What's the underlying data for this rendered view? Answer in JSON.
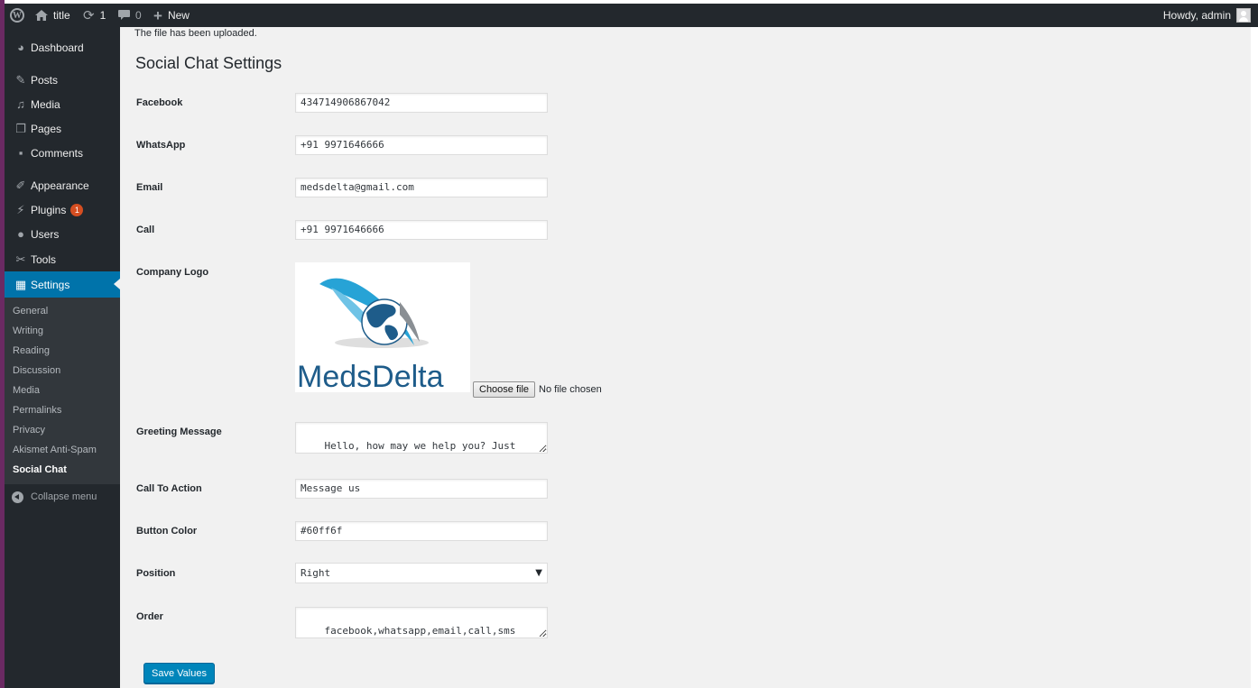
{
  "adminbar": {
    "site_title": "title",
    "updates_count": "1",
    "comments_count": "0",
    "new_label": "New",
    "howdy": "Howdy, admin"
  },
  "sidebar": {
    "items": [
      {
        "label": "Dashboard",
        "icon": "dashboard-icon"
      },
      {
        "label": "Posts",
        "icon": "pin-icon"
      },
      {
        "label": "Media",
        "icon": "media-icon"
      },
      {
        "label": "Pages",
        "icon": "pages-icon"
      },
      {
        "label": "Comments",
        "icon": "comments-icon"
      },
      {
        "label": "Appearance",
        "icon": "brush-icon"
      },
      {
        "label": "Plugins",
        "icon": "plug-icon",
        "badge": "1"
      },
      {
        "label": "Users",
        "icon": "user-icon"
      },
      {
        "label": "Tools",
        "icon": "wrench-icon"
      },
      {
        "label": "Settings",
        "icon": "settings-icon"
      }
    ],
    "submenu": [
      "General",
      "Writing",
      "Reading",
      "Discussion",
      "Media",
      "Permalinks",
      "Privacy",
      "Akismet Anti-Spam",
      "Social Chat"
    ],
    "collapse_label": "Collapse menu"
  },
  "main": {
    "notice": "The file has been uploaded.",
    "title": "Social Chat Settings",
    "fields": {
      "facebook": {
        "label": "Facebook",
        "value": "434714906867042"
      },
      "whatsapp": {
        "label": "WhatsApp",
        "value": "+91 9971646666"
      },
      "email": {
        "label": "Email",
        "value": "medsdelta@gmail.com"
      },
      "call": {
        "label": "Call",
        "value": "+91 9971646666"
      },
      "logo": {
        "label": "Company Logo",
        "logo_text": "MedsDelta",
        "choose_label": "Choose file",
        "no_file": "No file chosen"
      },
      "greeting": {
        "label": "Greeting Message",
        "value": "Hello, how may we help you? Just send us a message now to get assistance."
      },
      "cta": {
        "label": "Call To Action",
        "value": "Message us"
      },
      "button_color": {
        "label": "Button Color",
        "value": "#60ff6f"
      },
      "position": {
        "label": "Position",
        "value": "Right"
      },
      "order": {
        "label": "Order",
        "value": "facebook,whatsapp,email,call,sms"
      }
    },
    "save_label": "Save Values"
  },
  "colors": {
    "adminbar_bg": "#23282d",
    "sidebar_bg": "#23282d",
    "submenu_bg": "#32373c",
    "accent": "#0073aa",
    "button_primary": "#0085ba",
    "content_bg": "#f1f1f1",
    "logo_blue": "#1e5c8a",
    "logo_cyan": "#27a3d6"
  }
}
